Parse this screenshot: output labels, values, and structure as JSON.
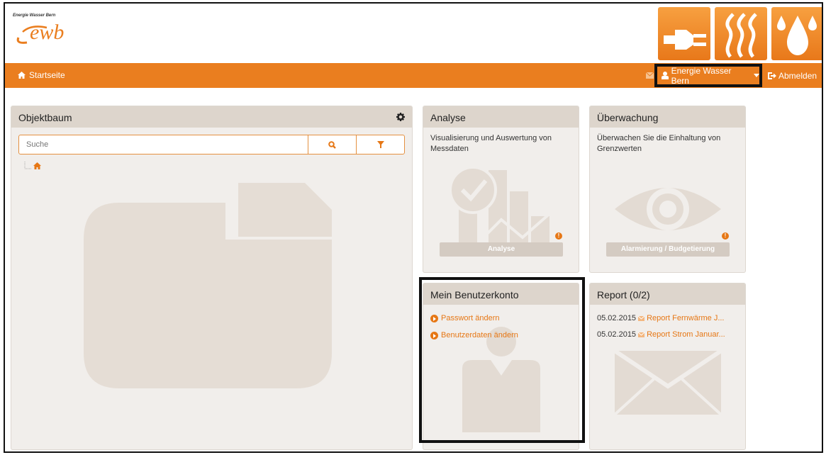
{
  "header": {
    "logo_tagline": "Energie Wasser Bern",
    "logo_text": "ewb",
    "service_tiles": [
      "power-plug-icon",
      "heat-waves-icon",
      "water-drops-icon"
    ]
  },
  "navbar": {
    "home_label": "Startseite",
    "user_label": "Energie Wasser Bern",
    "logout_label": "Abmelden"
  },
  "objektbaum": {
    "title": "Objektbaum",
    "search_placeholder": "Suche"
  },
  "analyse": {
    "title": "Analyse",
    "description": "Visualisierung und Auswertung von Messdaten",
    "button_label": "Analyse"
  },
  "ueberwachung": {
    "title": "Überwachung",
    "description": "Überwachen Sie die Einhaltung von Grenzwerten",
    "button_label": "Alarmierung / Budgetierung"
  },
  "konto": {
    "title": "Mein Benutzerkonto",
    "links": [
      "Passwort ändern",
      "Benutzerdaten ändern"
    ]
  },
  "report": {
    "title": "Report (0/2)",
    "items": [
      {
        "date": "05.02.2015",
        "label": "Report Fernwärme J..."
      },
      {
        "date": "05.02.2015",
        "label": "Report Strom Januar..."
      }
    ]
  },
  "colors": {
    "brand_orange": "#ea7e1f",
    "panel_bg": "#f1eeeb",
    "panel_header": "#ddd5cc"
  }
}
